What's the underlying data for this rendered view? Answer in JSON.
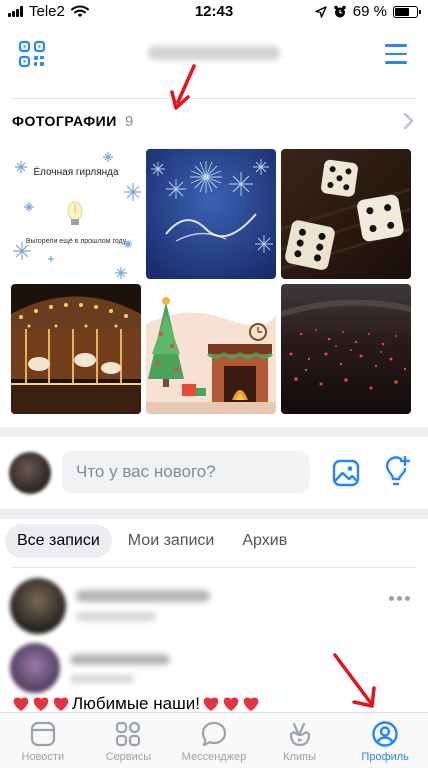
{
  "status_bar": {
    "carrier": "Tele2",
    "time": "12:43",
    "battery_percent": "69 %",
    "battery_level": 0.69
  },
  "header": {
    "qr_icon": "qr-code-icon",
    "menu_icon": "hamburger-menu-icon"
  },
  "photos": {
    "title": "ФОТОГРАФИИ",
    "count": "9",
    "items": [
      {
        "title": "Ёлочная гирлянда",
        "caption": "Выгорели ещё в прошлом году"
      },
      {
        "title": "",
        "caption": ""
      },
      {
        "title": "",
        "caption": ""
      },
      {
        "title": "",
        "caption": ""
      },
      {
        "title": "",
        "caption": ""
      },
      {
        "title": "",
        "caption": ""
      }
    ]
  },
  "composer": {
    "placeholder": "Что у вас нового?"
  },
  "feed_tabs": [
    {
      "label": "Все записи",
      "active": true
    },
    {
      "label": "Мои записи",
      "active": false
    },
    {
      "label": "Архив",
      "active": false
    }
  ],
  "post": {
    "text": "Любимые наши!"
  },
  "tabbar": [
    {
      "label": "Новости",
      "icon": "news-icon",
      "active": false
    },
    {
      "label": "Сервисы",
      "icon": "services-icon",
      "active": false
    },
    {
      "label": "Мессенджер",
      "icon": "messenger-icon",
      "active": false
    },
    {
      "label": "Клипы",
      "icon": "clips-icon",
      "active": false
    },
    {
      "label": "Профиль",
      "icon": "profile-icon",
      "active": true
    }
  ],
  "colors": {
    "accent": "#2787f5",
    "annotation": "#e8121b",
    "inactive": "#99a2ad"
  }
}
